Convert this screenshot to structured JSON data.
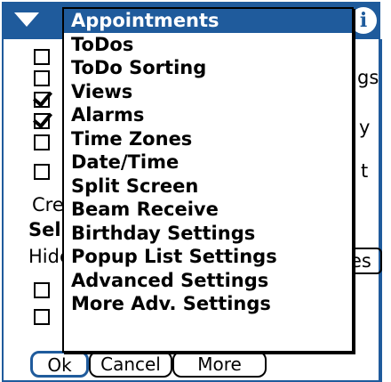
{
  "titlebar": {
    "menu_arrow": "menu-arrow-icon",
    "info_label": "i"
  },
  "behind": {
    "peek_texts": [
      "gs",
      "y",
      "t"
    ],
    "create_label": "Cre",
    "select_label": "Sel",
    "hide_label": "Hide",
    "hide_button_tail": "es"
  },
  "checkboxes": [
    {
      "checked": false
    },
    {
      "checked": false
    },
    {
      "checked": true
    },
    {
      "checked": true
    },
    {
      "checked": false
    },
    {
      "checked": false
    },
    {
      "checked": false
    },
    {
      "checked": false
    }
  ],
  "buttons": {
    "ok": "Ok",
    "cancel": "Cancel",
    "more": "More"
  },
  "popup": {
    "items": [
      "Appointments",
      "ToDos",
      "ToDo Sorting",
      "Views",
      "Alarms",
      "Time Zones",
      "Date/Time",
      "Split Screen",
      "Beam Receive",
      "Birthday Settings",
      "Popup List Settings",
      "Advanced Settings",
      "More Adv. Settings"
    ],
    "selected_index": 0
  },
  "colors": {
    "accent": "#1f5b9c",
    "background": "#ffffff"
  }
}
